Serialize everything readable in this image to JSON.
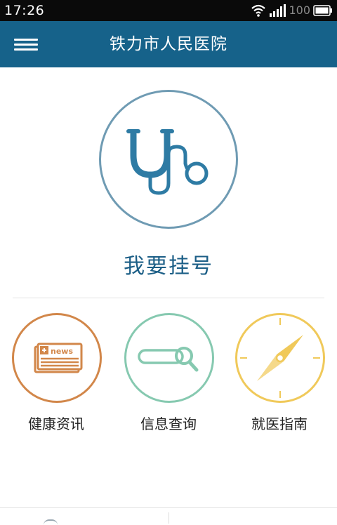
{
  "status_bar": {
    "time": "17:26",
    "battery_level": "100",
    "icons": [
      "wifi-icon",
      "signal-icon",
      "battery-icon"
    ]
  },
  "header": {
    "menu_icon": "hamburger-menu-icon",
    "title": "铁力市人民医院"
  },
  "register": {
    "icon": "stethoscope-icon",
    "label": "我要挂号"
  },
  "quick_links": [
    {
      "label": "健康资讯",
      "icon": "newspaper-icon",
      "badge_text": "news",
      "color": "#d2874a"
    },
    {
      "label": "信息查询",
      "icon": "search-bar-icon",
      "color": "#86c9b0"
    },
    {
      "label": "就医指南",
      "icon": "compass-icon",
      "color": "#f0c95a"
    }
  ],
  "colors": {
    "header_bg": "#16628a",
    "register_accent": "#2e7ba4",
    "register_ring": "#6f9bb3"
  }
}
